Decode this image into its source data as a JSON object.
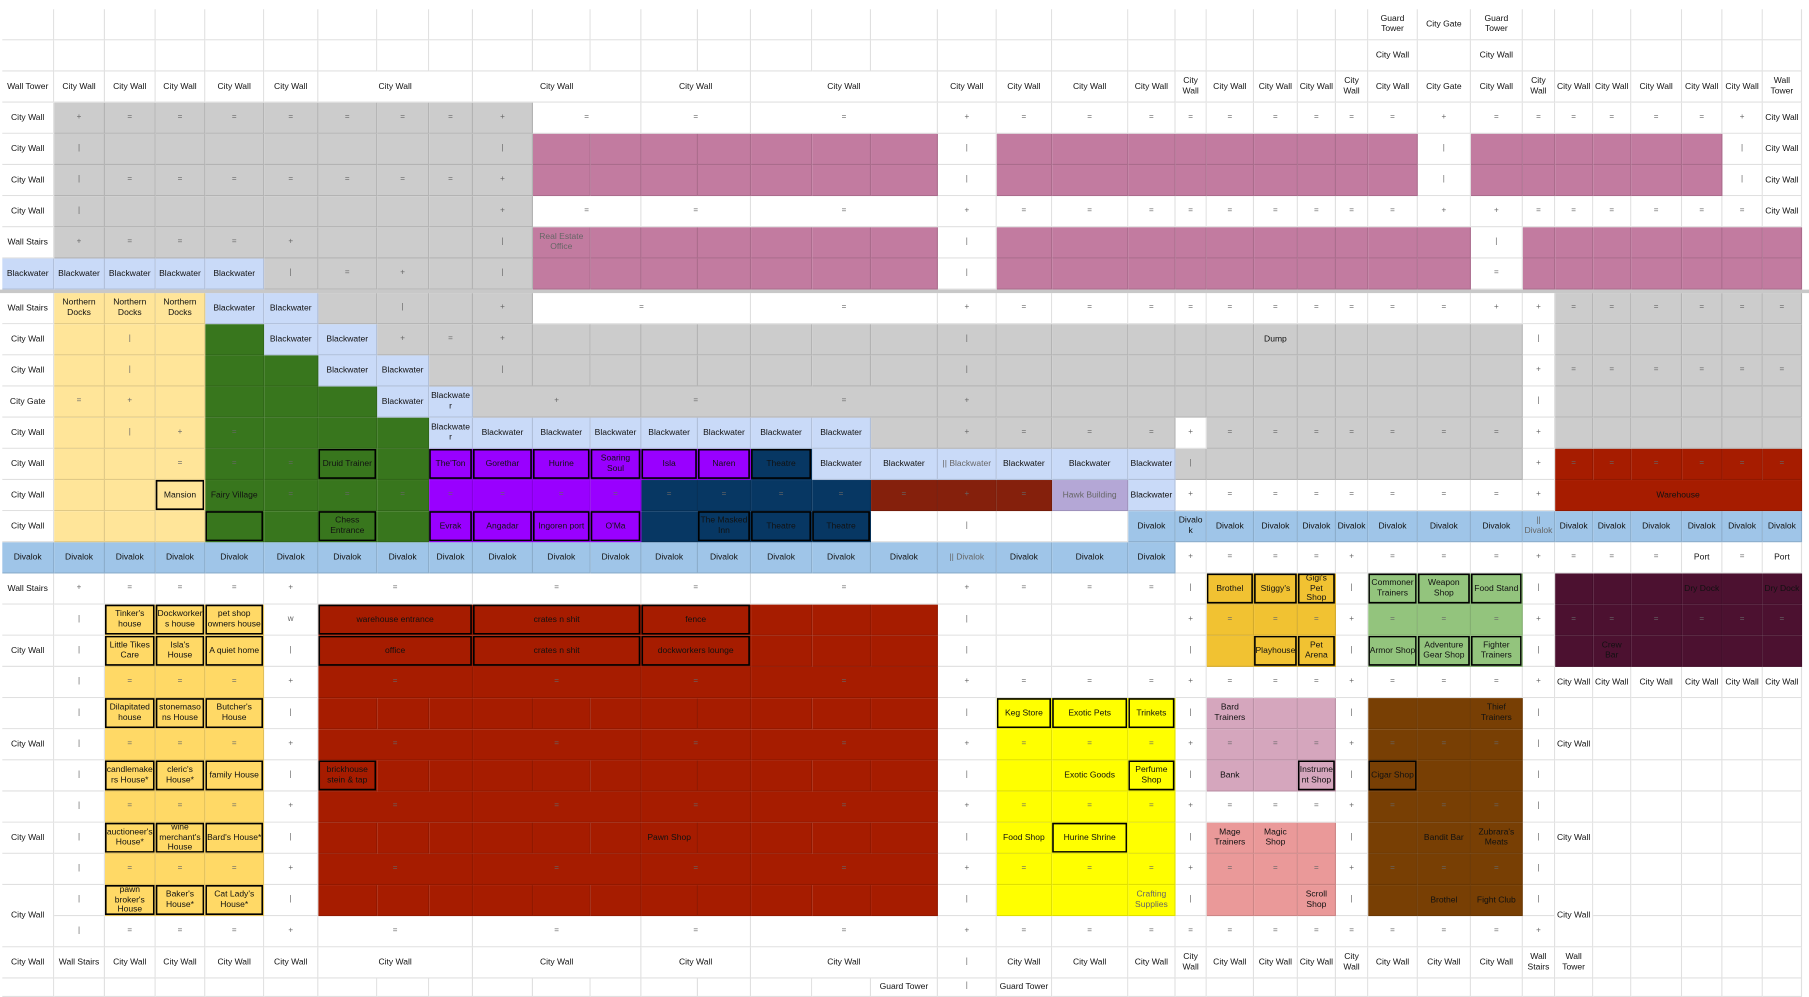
{
  "app": "Spreadsheet city map",
  "palette": {
    "white": "#ffffff",
    "grey": "#cccccc",
    "pink": "#c27ba0",
    "lightblue": "#c9daf8",
    "blue": "#9fc5e8",
    "lightyellow": "#ffe599",
    "green": "#38761d",
    "purple": "#9900ff",
    "navy": "#073763",
    "darkred": "#85200c",
    "red": "#a61c00",
    "lilac": "#b4a7d6",
    "houseyellow": "#ffd966",
    "amber": "#f1c232",
    "lightgreen": "#93c47d",
    "maroon": "#4c1130",
    "brightyellow": "#ffff00",
    "lightpink": "#d5a6bd",
    "salmon": "#ea9999",
    "brown": "#783f04"
  },
  "grid": {
    "rows": {
      "0": {
        "26": "Guard Tower",
        "27": "City Gate",
        "28": "Guard Tower"
      },
      "1": {
        "26": "City Wall",
        "28": "City Wall"
      },
      "2": {
        "0": "Wall Tower",
        "1": "City Wall",
        "2": "City Wall",
        "3": "City Wall",
        "4": "City Wall",
        "5": "City Wall",
        "6": "City Wall",
        "9": "City Wall",
        "12": "City Wall",
        "14": "City Wall",
        "17": "City Wall",
        "18": "City Wall",
        "19": "City Wall",
        "20": "City Wall",
        "21": "City Wall",
        "22": "City Wall",
        "23": "City Wall",
        "24": "City Wall",
        "25": "City Wall",
        "26": "City Wall",
        "27": "City Gate",
        "28": "City Wall",
        "29": "City Wall",
        "30": "City Wall",
        "31": "City Wall",
        "32": "City Wall",
        "33": "City Wall",
        "34": "City Wall",
        "35": "Wall Tower"
      },
      "3": {
        "0": "City Wall",
        "1": "+",
        "2": "=",
        "3": "=",
        "4": "=",
        "5": "=",
        "6": "=",
        "7": "=",
        "8": "=",
        "9": "+",
        "10": "=",
        "12": "=",
        "14": "=",
        "17": "+",
        "18": "=",
        "19": "=",
        "20": "=",
        "21": "=",
        "22": "=",
        "23": "=",
        "24": "=",
        "25": "=",
        "26": "=",
        "27": "+",
        "28": "=",
        "29": "=",
        "30": "=",
        "31": "=",
        "32": "=",
        "33": "=",
        "34": "+",
        "35": "City Wall"
      },
      "4": {
        "0": "City Wall",
        "1": "|",
        "9": "|",
        "17": "|",
        "27": "|",
        "34": "|",
        "35": "City Wall"
      },
      "5": {
        "0": "City Wall",
        "1": "|",
        "2": "=",
        "3": "=",
        "4": "=",
        "5": "=",
        "6": "=",
        "7": "=",
        "8": "=",
        "9": "+",
        "17": "|",
        "27": "|",
        "34": "|",
        "35": "City Wall"
      },
      "6": {
        "0": "City Wall",
        "1": "|",
        "9": "+",
        "10": "=",
        "12": "=",
        "14": "=",
        "17": "+",
        "18": "=",
        "19": "=",
        "20": "=",
        "21": "=",
        "22": "=",
        "23": "=",
        "24": "=",
        "25": "=",
        "26": "=",
        "27": "+",
        "28": "+",
        "29": "=",
        "30": "=",
        "31": "=",
        "32": "=",
        "33": "=",
        "34": "=",
        "35": "City Wall"
      },
      "7": {
        "0": "Wall Stairs",
        "1": "+",
        "2": "=",
        "3": "=",
        "4": "=",
        "5": "+",
        "9": "|",
        "10": "Real Estate Office",
        "17": "|",
        "28": "|"
      },
      "8": {
        "0": "Blackwater",
        "1": "Blackwater",
        "2": "Blackwater",
        "3": "Blackwater",
        "4": "Blackwater",
        "5": "|",
        "6": "=",
        "7": "+",
        "9": "|",
        "17": "|",
        "28": "="
      },
      "9": {
        "0": "Wall Stairs",
        "1": "Northern Docks",
        "2": "Northern Docks",
        "3": "Northern Docks",
        "4": "Blackwater",
        "5": "Blackwater",
        "7": "|",
        "9": "+",
        "10": "=",
        "14": "=",
        "17": "+",
        "18": "=",
        "19": "=",
        "20": "=",
        "21": "=",
        "22": "=",
        "23": "=",
        "24": "=",
        "25": "=",
        "26": "=",
        "27": "=",
        "28": "+",
        "29": "+",
        "30": "=",
        "31": "=",
        "32": "=",
        "33": "=",
        "34": "=",
        "35": "="
      },
      "10": {
        "0": "City Wall",
        "2": "|",
        "5": "Blackwater",
        "6": "Blackwater",
        "7": "+",
        "8": "=",
        "9": "+",
        "17": "|",
        "23": "Dump",
        "29": "|"
      },
      "11": {
        "0": "City Wall",
        "2": "|",
        "6": "Blackwater",
        "7": "Blackwater",
        "9": "|",
        "17": "|",
        "29": "+",
        "30": "=",
        "31": "=",
        "32": "=",
        "33": "=",
        "34": "=",
        "35": "="
      },
      "12": {
        "0": "City Gate",
        "1": "=",
        "2": "+",
        "7": "Blackwater",
        "8": "Blackwater",
        "9": "+",
        "12": "=",
        "14": "=",
        "17": "+",
        "29": "|"
      },
      "13": {
        "0": "City Wall",
        "2": "|",
        "3": "+",
        "4": "=",
        "8": "Blackwater",
        "9": "Blackwater",
        "10": "Blackwater",
        "11": "Blackwater",
        "12": "Blackwater",
        "13": "Blackwater",
        "14": "Blackwater",
        "15": "Blackwater",
        "17": "+",
        "18": "=",
        "19": "=",
        "20": "=",
        "21": "+",
        "22": "=",
        "23": "=",
        "24": "=",
        "25": "=",
        "26": "=",
        "27": "=",
        "28": "=",
        "29": "+"
      },
      "14": {
        "0": "City Wall",
        "3": "=",
        "4": "=",
        "5": "=",
        "6": "Druid Trainer",
        "8": "The'Ton",
        "9": "Gorethar",
        "10": "Hurine",
        "11": "Soaring Soul",
        "12": "Isla",
        "13": "Naren",
        "14": "Theatre",
        "15": "Blackwater",
        "16": "Blackwater",
        "17": "|| Blackwater",
        "18": "Blackwater",
        "19": "Blackwater",
        "20": "Blackwater",
        "21": "|",
        "29": "+",
        "30": "=",
        "31": "=",
        "32": "=",
        "33": "=",
        "34": "=",
        "35": "="
      },
      "15": {
        "0": "City Wall",
        "3": "Mansion",
        "4": "Fairy Village",
        "5": "=",
        "6": "=",
        "7": "=",
        "8": "=",
        "9": "=",
        "10": "=",
        "11": "=",
        "12": "=",
        "13": "=",
        "14": "=",
        "15": "=",
        "16": "=",
        "17": "+",
        "18": "=",
        "19": "Hawk Building",
        "20": "Blackwater",
        "21": "+",
        "22": "=",
        "23": "=",
        "24": "=",
        "25": "=",
        "26": "=",
        "27": "=",
        "28": "=",
        "29": "+",
        "30": "Warehouse"
      },
      "16": {
        "0": "City Wall",
        "6": "Chess Entrance",
        "8": "Evrak",
        "9": "Angadar",
        "10": "Ingoren port",
        "11": "O'Ma",
        "13": "The Masked Inn",
        "14": "Theatre",
        "15": "Theatre",
        "17": "|",
        "20": "Divalok",
        "21": "Divalok",
        "22": "Divalok",
        "23": "Divalok",
        "24": "Divalok",
        "25": "Divalok",
        "26": "Divalok",
        "27": "Divalok",
        "28": "Divalok",
        "29": "|| Divalok",
        "30": "Divalok",
        "31": "Divalok",
        "32": "Divalok",
        "33": "Divalok",
        "34": "Divalok",
        "35": "Divalok"
      },
      "17": {
        "0": "Divalok",
        "1": "Divalok",
        "2": "Divalok",
        "3": "Divalok",
        "4": "Divalok",
        "5": "Divalok",
        "6": "Divalok",
        "7": "Divalok",
        "8": "Divalok",
        "9": "Divalok",
        "10": "Divalok",
        "11": "Divalok",
        "12": "Divalok",
        "13": "Divalok",
        "14": "Divalok",
        "15": "Divalok",
        "16": "Divalok",
        "17": "|| Divalok",
        "18": "Divalok",
        "19": "Divalok",
        "20": "Divalok",
        "21": "+",
        "22": "=",
        "23": "=",
        "24": "=",
        "25": "+",
        "26": "=",
        "27": "=",
        "28": "=",
        "29": "+",
        "30": "=",
        "31": "=",
        "32": "=",
        "33": "Port",
        "34": "=",
        "35": "Port"
      },
      "18": {
        "0": "Wall Stairs",
        "1": "+",
        "2": "=",
        "3": "=",
        "4": "=",
        "5": "+",
        "6": "=",
        "9": "=",
        "12": "=",
        "14": "=",
        "17": "+",
        "18": "=",
        "19": "=",
        "20": "=",
        "21": "|",
        "22": "Brothel",
        "23": "Stiggy's",
        "24": "Gigi's Pet Shop",
        "25": "|",
        "26": "Commoner Trainers",
        "27": "Weapon Shop",
        "28": "Food Stand",
        "29": "|",
        "33": "Dry Dock",
        "35": "Dry Dock"
      },
      "19": {
        "1": "|",
        "2": "Tinker's house",
        "3": "Dockworkers house",
        "4": "pet shop owners house",
        "5": "w",
        "6": "warehouse entrance",
        "9": "crates n shit",
        "12": "fence",
        "17": "|",
        "21": "+",
        "22": "=",
        "23": "=",
        "24": "=",
        "25": "+",
        "26": "=",
        "27": "=",
        "28": "=",
        "29": "+",
        "30": "=",
        "31": "=",
        "32": "=",
        "33": "=",
        "34": "=",
        "35": "="
      },
      "20": {
        "0": "City Wall",
        "1": "|",
        "2": "Little Tikes Care",
        "3": "Isla's House",
        "4": "A quiet home",
        "5": "|",
        "6": "office",
        "9": "crates n shit",
        "12": "dockworkers lounge",
        "17": "|",
        "21": "|",
        "23": "Playhouse",
        "24": "Pet Arena",
        "25": "|",
        "26": "Armor Shop",
        "27": "Adventure Gear Shop",
        "28": "Fighter Trainers",
        "29": "|",
        "31": "Crew Bar"
      },
      "21": {
        "1": "|",
        "2": "=",
        "3": "=",
        "4": "=",
        "5": "+",
        "6": "=",
        "9": "=",
        "12": "=",
        "14": "=",
        "17": "+",
        "18": "=",
        "19": "=",
        "20": "=",
        "21": "+",
        "22": "=",
        "23": "=",
        "24": "=",
        "25": "+",
        "26": "=",
        "27": "=",
        "28": "=",
        "29": "+",
        "30": "City Wall",
        "31": "City Wall",
        "32": "City Wall",
        "33": "City Wall",
        "34": "City Wall",
        "35": "City Wall"
      },
      "22": {
        "1": "|",
        "2": "Dilapitated house",
        "3": "stonemasons House",
        "4": "Butcher's House",
        "5": "|",
        "17": "|",
        "18": "Keg Store",
        "19": "Exotic Pets",
        "20": "Trinkets",
        "21": "|",
        "22": "Bard Trainers",
        "25": "|",
        "28": "Thief Trainers",
        "29": "|"
      },
      "23": {
        "0": "City Wall",
        "1": "|",
        "2": "=",
        "3": "=",
        "4": "=",
        "5": "+",
        "6": "=",
        "9": "=",
        "12": "=",
        "14": "=",
        "17": "+",
        "18": "=",
        "19": "=",
        "20": "=",
        "21": "+",
        "22": "=",
        "23": "=",
        "24": "=",
        "25": "+",
        "26": "=",
        "27": "=",
        "28": "=",
        "29": "|",
        "30": "City Wall"
      },
      "24": {
        "1": "|",
        "2": "candlemakers House*",
        "3": "cleric's House*",
        "4": "family House",
        "5": "|",
        "6": "brickhouse stein & tap",
        "17": "|",
        "19": "Exotic Goods",
        "20": "Perfume Shop",
        "21": "|",
        "22": "Bank",
        "24": "Instrument Shop",
        "25": "|",
        "26": "Cigar Shop",
        "29": "|"
      },
      "25": {
        "1": "|",
        "2": "=",
        "3": "=",
        "4": "=",
        "5": "+",
        "6": "=",
        "9": "=",
        "12": "=",
        "14": "=",
        "17": "+",
        "18": "=",
        "19": "=",
        "20": "=",
        "21": "+",
        "22": "=",
        "23": "=",
        "24": "=",
        "25": "+",
        "26": "=",
        "27": "=",
        "28": "=",
        "29": "|"
      },
      "26": {
        "0": "City Wall",
        "1": "|",
        "2": "auctioneer's House*",
        "3": "wine merchant's House",
        "4": "Bard's House*",
        "5": "|",
        "12": "Pawn Shop",
        "17": "|",
        "18": "Food Shop",
        "19": "Hurine Shrine",
        "21": "|",
        "22": "Mage Trainers",
        "23": "Magic Shop",
        "25": "|",
        "27": "Bandit Bar",
        "28": "Zubrara's Meats",
        "29": "|",
        "30": "City Wall"
      },
      "27": {
        "1": "|",
        "2": "=",
        "3": "=",
        "4": "=",
        "5": "+",
        "6": "=",
        "9": "=",
        "12": "=",
        "14": "=",
        "17": "+",
        "18": "=",
        "19": "=",
        "20": "=",
        "21": "+",
        "22": "=",
        "23": "=",
        "24": "=",
        "25": "+",
        "26": "=",
        "27": "=",
        "28": "=",
        "29": "|"
      },
      "28": {
        "0": "City Wall",
        "1": "|",
        "2": "pawn broker's House",
        "3": "Baker's House*",
        "4": "Cat Lady's House*",
        "5": "|",
        "17": "|",
        "20": "Crafting Supplies",
        "21": "|",
        "24": "Scroll Shop",
        "25": "|",
        "27": "Brothel",
        "28": "Fight Club",
        "29": "|",
        "30": "City Wall"
      },
      "29": {
        "1": "|",
        "2": "=",
        "3": "=",
        "4": "=",
        "5": "+",
        "6": "=",
        "9": "=",
        "12": "=",
        "14": "=",
        "17": "+",
        "18": "=",
        "19": "=",
        "20": "=",
        "21": "=",
        "22": "=",
        "23": "=",
        "24": "=",
        "25": "=",
        "26": "=",
        "27": "=",
        "28": "=",
        "29": "+"
      },
      "30": {
        "0": "City Wall",
        "1": "Wall Stairs",
        "2": "City Wall",
        "3": "City Wall",
        "4": "City Wall",
        "5": "City Wall",
        "6": "City Wall",
        "9": "City Wall",
        "12": "City Wall",
        "14": "City Wall",
        "17": "|",
        "18": "City Wall",
        "19": "City Wall",
        "20": "City Wall",
        "21": "City Wall",
        "22": "City Wall",
        "23": "City Wall",
        "24": "City Wall",
        "25": "City Wall",
        "26": "City Wall",
        "27": "City Wall",
        "28": "City Wall",
        "29": "Wall Stairs",
        "30": "Wall Tower"
      },
      "31": {
        "16": "Guard Tower",
        "17": "|",
        "18": "Guard Tower"
      }
    }
  }
}
